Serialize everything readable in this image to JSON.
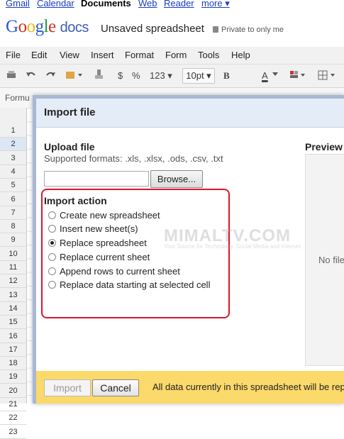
{
  "topnav": {
    "gmail": "Gmail",
    "calendar": "Calendar",
    "documents": "Documents",
    "web": "Web",
    "reader": "Reader",
    "more": "more ▾"
  },
  "header": {
    "logo_google": "Google",
    "logo_docs": "docs",
    "title": "Unsaved spreadsheet",
    "privacy": "Private to only me"
  },
  "menu": [
    "File",
    "Edit",
    "View",
    "Insert",
    "Format",
    "Form",
    "Tools",
    "Help"
  ],
  "toolbar": {
    "currency": "$",
    "percent": "%",
    "number_format": "123 ▾",
    "font_size": "10pt ▾",
    "bold": "B",
    "text_color": "A"
  },
  "formula": {
    "label": "Formu"
  },
  "rows": [
    "1",
    "2",
    "3",
    "4",
    "5",
    "6",
    "7",
    "8",
    "9",
    "10",
    "11",
    "12",
    "13",
    "14",
    "15",
    "16",
    "17",
    "18",
    "19",
    "20",
    "21",
    "22",
    "23"
  ],
  "dialog": {
    "title": "Import file",
    "upload_heading": "Upload file",
    "formats": "Supported formats: .xls, .xlsx, .ods, .csv, .txt",
    "browse": "Browse...",
    "action_heading": "Import action",
    "options": [
      {
        "label": "Create new spreadsheet",
        "checked": false
      },
      {
        "label": "Insert new sheet(s)",
        "checked": false
      },
      {
        "label": "Replace spreadsheet",
        "checked": true
      },
      {
        "label": "Replace current sheet",
        "checked": false
      },
      {
        "label": "Append rows to current sheet",
        "checked": false
      },
      {
        "label": "Replace data starting at selected cell",
        "checked": false
      }
    ],
    "preview_heading": "Preview",
    "preview_empty": "No file",
    "import_button": "Import",
    "cancel_button": "Cancel",
    "footer_message": "All data currently in this spreadsheet will be rep"
  },
  "watermark": {
    "main": "MIMALTV.COM",
    "sub": "Your Source for Technology, Social Media and Internet"
  },
  "colors": {
    "accent": "#e0142a",
    "footer": "#fbd96a",
    "title_bar": "#e4ecf7"
  }
}
